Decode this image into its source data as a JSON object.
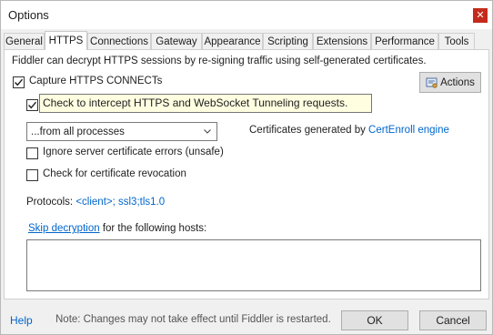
{
  "window": {
    "title": "Options",
    "close_glyph": "✕"
  },
  "tabs": [
    {
      "label": "General",
      "active": false
    },
    {
      "label": "HTTPS",
      "active": true
    },
    {
      "label": "Connections",
      "active": false
    },
    {
      "label": "Gateway",
      "active": false
    },
    {
      "label": "Appearance",
      "active": false
    },
    {
      "label": "Scripting",
      "active": false
    },
    {
      "label": "Extensions",
      "active": false
    },
    {
      "label": "Performance",
      "active": false
    },
    {
      "label": "Tools",
      "active": false
    }
  ],
  "https": {
    "description": "Fiddler can decrypt HTTPS sessions by re-signing traffic using self-generated certificates.",
    "capture_connects": {
      "label": "Capture HTTPS CONNECTs",
      "checked": true
    },
    "decrypt_traffic": {
      "checked": true
    },
    "tooltip": "Check to intercept HTTPS and WebSocket Tunneling requests.",
    "actions_button": "Actions",
    "process_filter": {
      "selected": "...from all processes"
    },
    "certs_prefix": "Certificates generated by ",
    "certs_link": "CertEnroll engine",
    "ignore_errors": {
      "label": "Ignore server certificate errors (unsafe)",
      "checked": false
    },
    "revocation": {
      "label": "Check for certificate revocation",
      "checked": false
    },
    "protocols_label": "Protocols: ",
    "protocols_value": "<client>; ssl3;tls1.0",
    "skip_link": "Skip decryption",
    "skip_suffix": " for the following hosts:",
    "hosts_value": ""
  },
  "footer": {
    "help": "Help",
    "note": "Note: Changes may not take effect until Fiddler is restarted.",
    "ok": "OK",
    "cancel": "Cancel"
  },
  "icons": {
    "close": "close-icon",
    "check": "checkmark-icon",
    "actions": "certificate-actions-icon",
    "dropdown": "chevron-down-icon"
  },
  "colors": {
    "link": "#0066cc",
    "tooltip_bg": "#fffee1",
    "close_bg": "#c42b1c",
    "checkbox_check": "#1e1e1e"
  }
}
